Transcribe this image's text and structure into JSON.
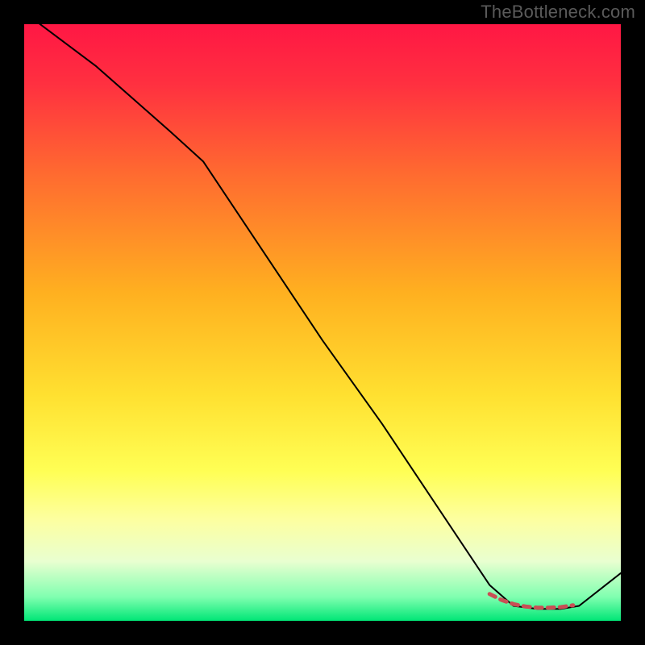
{
  "watermark": "TheBottleneck.com",
  "chart_data": {
    "type": "line",
    "title": "",
    "xlabel": "",
    "ylabel": "",
    "xlim": [
      0,
      100
    ],
    "ylim": [
      0,
      100
    ],
    "grid": false,
    "legend": false,
    "background_gradient": {
      "stops": [
        {
          "offset": 0.0,
          "color": "#ff1744"
        },
        {
          "offset": 0.1,
          "color": "#ff3040"
        },
        {
          "offset": 0.25,
          "color": "#ff6a30"
        },
        {
          "offset": 0.45,
          "color": "#ffb020"
        },
        {
          "offset": 0.62,
          "color": "#ffe030"
        },
        {
          "offset": 0.75,
          "color": "#ffff55"
        },
        {
          "offset": 0.83,
          "color": "#fdffa0"
        },
        {
          "offset": 0.9,
          "color": "#e9ffd0"
        },
        {
          "offset": 0.96,
          "color": "#80ffb0"
        },
        {
          "offset": 1.0,
          "color": "#00e676"
        }
      ]
    },
    "series": [
      {
        "name": "curve",
        "color": "#000000",
        "width": 2,
        "x": [
          0.0,
          12.0,
          24.5,
          30.0,
          40.0,
          50.0,
          60.0,
          70.0,
          78.0,
          82.0,
          86.0,
          90.0,
          93.0,
          100.0
        ],
        "y": [
          102.0,
          93.0,
          82.0,
          77.0,
          62.0,
          47.0,
          33.0,
          18.0,
          6.0,
          2.5,
          2.0,
          2.0,
          2.5,
          8.0
        ]
      },
      {
        "name": "dash-segment",
        "color": "#c94f55",
        "width": 5,
        "dash": true,
        "x": [
          78.0,
          80.0,
          82.0,
          84.0,
          86.0,
          88.0,
          90.0,
          92.0
        ],
        "y": [
          4.5,
          3.5,
          2.8,
          2.4,
          2.2,
          2.2,
          2.3,
          2.6
        ]
      }
    ]
  }
}
